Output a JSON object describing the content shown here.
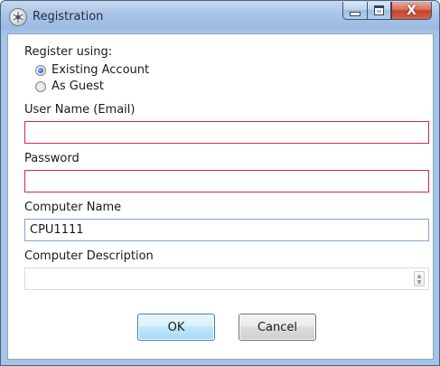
{
  "window": {
    "title": "Registration",
    "icon": "snowflake-app-icon",
    "caption_buttons": [
      "minimize-icon",
      "maximize-icon",
      "close-icon"
    ],
    "close_glyph": "X"
  },
  "form": {
    "register_using_label": "Register using:",
    "options": [
      {
        "label": "Existing Account",
        "checked": true
      },
      {
        "label": "As Guest",
        "checked": false
      }
    ],
    "username": {
      "label": "User Name (Email)",
      "value": "",
      "state": "error"
    },
    "password": {
      "label": "Password",
      "value": "",
      "state": "error"
    },
    "computer_name": {
      "label": "Computer Name",
      "value": "CPU1111"
    },
    "computer_description": {
      "label": "Computer Description",
      "value": "",
      "state": "disabled"
    }
  },
  "buttons": {
    "ok_label": "OK",
    "cancel_label": "Cancel"
  },
  "colors": {
    "error_border": "#d9293b",
    "focus_border": "#7fa6d4",
    "title_bar": "#aac5e6",
    "close_button": "#c4432a"
  }
}
